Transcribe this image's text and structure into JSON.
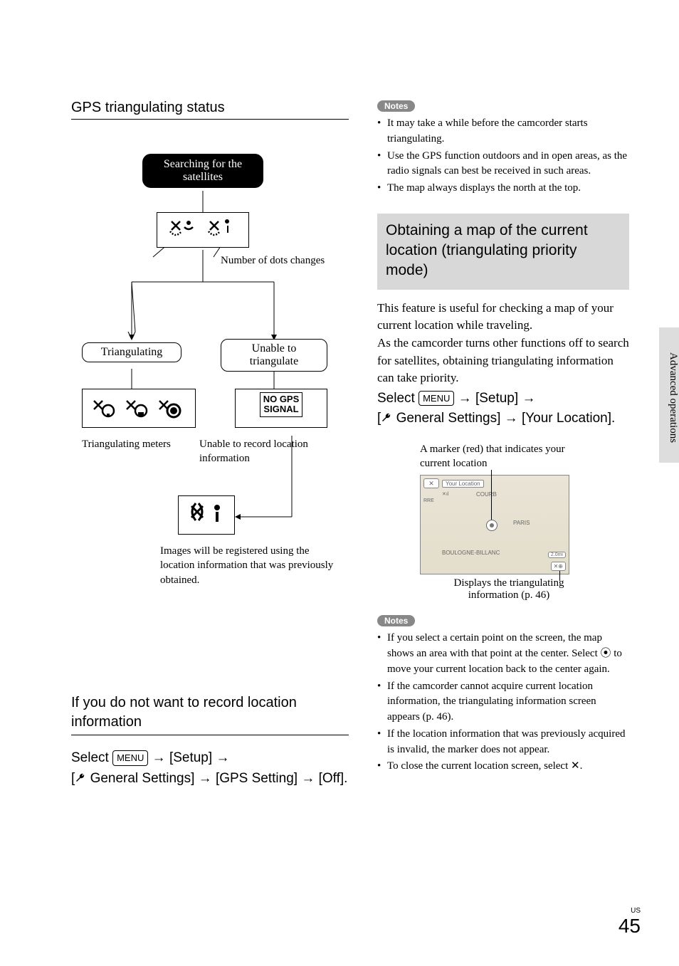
{
  "left": {
    "title": "GPS triangulating status",
    "flow": {
      "searching_box": "Searching for the\nsatellites",
      "num_dots": "Number of dots changes",
      "triangulating": "Triangulating",
      "unable_box": "Unable to triangulate",
      "no_gps": "NO GPS\nSIGNAL",
      "tri_meters": "Triangulating meters",
      "unable_record": "Unable to record location information",
      "prev_caption": "Images will be registered using the location information that was previously obtained."
    },
    "no_record_title": "If you do not want to record location information",
    "proc": {
      "select": "Select",
      "menu": "MENU",
      "setup": "[Setup]",
      "general": "General Settings]",
      "gps": "[GPS Setting]",
      "off": "[Off]."
    }
  },
  "right": {
    "notes_label": "Notes",
    "notes1": [
      "It may take a while before the camcorder starts triangulating.",
      "Use the GPS function outdoors and in open areas, as the radio signals can best be received in such areas.",
      "The map always displays the north at the top."
    ],
    "grey_heading": "Obtaining a map of the current location (triangulating priority mode)",
    "body1": "This feature is useful for checking a map of your current location while traveling.",
    "body2": "As the camcorder turns other functions off to search for satellites, obtaining triangulating information can take priority.",
    "proc": {
      "select": "Select",
      "menu": "MENU",
      "setup": "[Setup]",
      "general": "General Settings]",
      "your_loc": "[Your Location]."
    },
    "map": {
      "ann_top": "A marker (red) that indicates your current location",
      "tab_label": "Your Location",
      "place1": "COURB",
      "place2": "PARIS",
      "place3": "BOULOGNE-BILLANC",
      "scale": "2.0mi",
      "ann_bottom": "Displays the triangulating information (p. 46)"
    },
    "notes2": [
      "If you select a certain point on the screen, the map shows an area with that point at the center. Select ⦿ to move your current location back to the center again.",
      "If the camcorder cannot acquire current location information, the triangulating information screen appears (p. 46).",
      "If the location information that was previously acquired is invalid, the marker does not appear.",
      "To close the current location screen, select ✕."
    ]
  },
  "side_tab": "Advanced operations",
  "page": {
    "region": "US",
    "number": "45"
  }
}
